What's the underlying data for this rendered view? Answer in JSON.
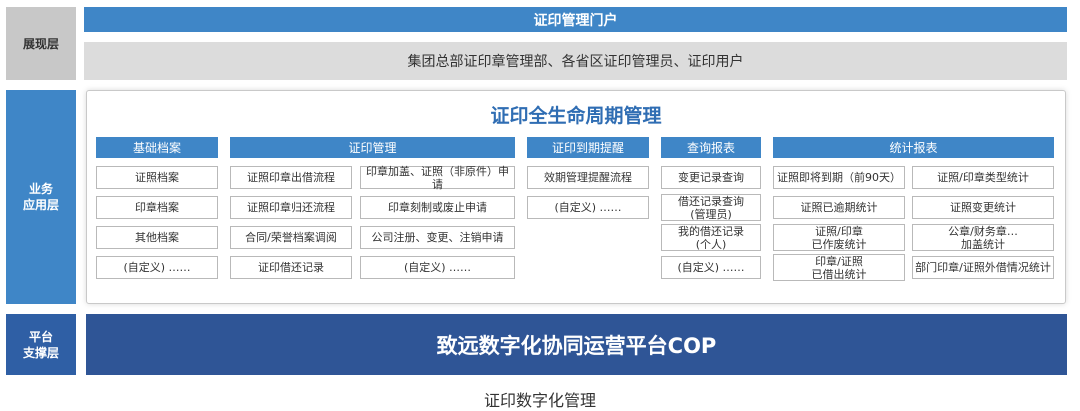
{
  "layers": {
    "presentation": "展现层",
    "business": "业务\n应用层",
    "platform": "平台\n支撑层"
  },
  "presentation": {
    "portal": "证印管理门户",
    "users": "集团总部证印章管理部、各省区证印管理员、证印用户"
  },
  "business": {
    "title": "证印全生命周期管理",
    "basic": {
      "header": "基础档案",
      "items": [
        "证照档案",
        "印章档案",
        "其他档案",
        "(自定义) ……"
      ]
    },
    "seal_mgmt": {
      "header": "证印管理",
      "left": [
        "证照印章出借流程",
        "证照印章归还流程",
        "合同/荣誉档案调阅",
        "证印借还记录"
      ],
      "right": [
        "印章加盖、证照（非原件）申请",
        "印章刻制或废止申请",
        "公司注册、变更、注销申请",
        "(自定义) ……"
      ]
    },
    "expiry": {
      "header": "证印到期提醒",
      "items": [
        "效期管理提醒流程",
        "(自定义) ……"
      ]
    },
    "query": {
      "header": "查询报表",
      "items": [
        "变更记录查询",
        "借还记录查询\n(管理员)",
        "我的借还记录\n(个人)",
        "(自定义) ……"
      ]
    },
    "stats": {
      "header": "统计报表",
      "left": [
        "证照即将到期（前90天）",
        "证照已逾期统计",
        "证照/印章\n已作废统计",
        "印章/证照\n已借出统计"
      ],
      "right": [
        "证照/印章类型统计",
        "证照变更统计",
        "公章/财务章…\n加盖统计",
        "部门印章/证照外借情况统计"
      ]
    }
  },
  "platform": {
    "name": "致远数字化协同运营平台COP"
  },
  "caption": "证印数字化管理"
}
